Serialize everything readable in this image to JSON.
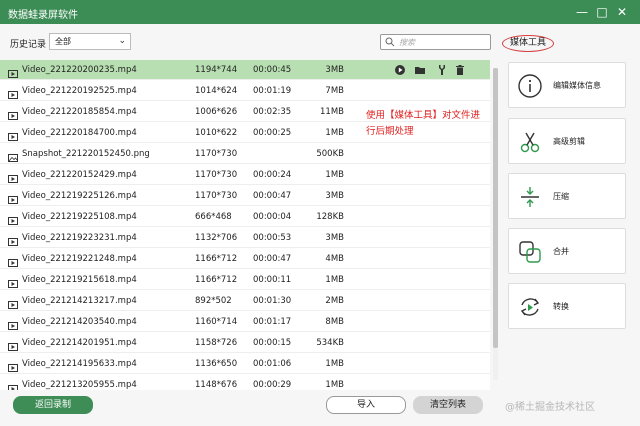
{
  "window": {
    "title": "数据蛙录屏软件",
    "min_icon": "minimize-icon",
    "max_icon": "maximize-icon",
    "close_icon": "close-icon"
  },
  "filter": {
    "label": "历史记录",
    "value": "全部"
  },
  "search": {
    "placeholder": "搜索"
  },
  "media_tab": {
    "label": "媒体工具"
  },
  "annotation": {
    "text": "使用【媒体工具】对文件进行后期处理"
  },
  "files": [
    {
      "name": "Video_221220200235.mp4",
      "resolution": "1194*744",
      "duration": "00:00:45",
      "size": "3MB",
      "type": "video",
      "selected": true
    },
    {
      "name": "Video_221220192525.mp4",
      "resolution": "1014*624",
      "duration": "00:01:19",
      "size": "7MB",
      "type": "video"
    },
    {
      "name": "Video_221220185854.mp4",
      "resolution": "1006*626",
      "duration": "00:02:35",
      "size": "11MB",
      "type": "video"
    },
    {
      "name": "Video_221220184700.mp4",
      "resolution": "1010*622",
      "duration": "00:00:25",
      "size": "1MB",
      "type": "video"
    },
    {
      "name": "Snapshot_221220152450.png",
      "resolution": "1170*730",
      "duration": "",
      "size": "500KB",
      "type": "image"
    },
    {
      "name": "Video_221220152429.mp4",
      "resolution": "1170*730",
      "duration": "00:00:24",
      "size": "1MB",
      "type": "video"
    },
    {
      "name": "Video_221219225126.mp4",
      "resolution": "1170*730",
      "duration": "00:00:47",
      "size": "3MB",
      "type": "video"
    },
    {
      "name": "Video_221219225108.mp4",
      "resolution": "666*468",
      "duration": "00:00:04",
      "size": "128KB",
      "type": "video"
    },
    {
      "name": "Video_221219223231.mp4",
      "resolution": "1132*706",
      "duration": "00:00:53",
      "size": "3MB",
      "type": "video"
    },
    {
      "name": "Video_221219221248.mp4",
      "resolution": "1166*712",
      "duration": "00:00:47",
      "size": "4MB",
      "type": "video"
    },
    {
      "name": "Video_221219215618.mp4",
      "resolution": "1166*712",
      "duration": "00:00:11",
      "size": "1MB",
      "type": "video"
    },
    {
      "name": "Video_221214213217.mp4",
      "resolution": "892*502",
      "duration": "00:01:30",
      "size": "2MB",
      "type": "video"
    },
    {
      "name": "Video_221214203540.mp4",
      "resolution": "1160*714",
      "duration": "00:01:17",
      "size": "8MB",
      "type": "video"
    },
    {
      "name": "Video_221214201951.mp4",
      "resolution": "1158*726",
      "duration": "00:00:15",
      "size": "534KB",
      "type": "video"
    },
    {
      "name": "Video_221214195633.mp4",
      "resolution": "1136*650",
      "duration": "00:01:06",
      "size": "1MB",
      "type": "video"
    },
    {
      "name": "Video_221213205955.mp4",
      "resolution": "1148*676",
      "duration": "00:00:29",
      "size": "1MB",
      "type": "video"
    }
  ],
  "row_actions": [
    "play-icon",
    "folder-icon",
    "trim-icon",
    "delete-icon"
  ],
  "tools": [
    {
      "label": "编辑媒体信息",
      "icon": "info-icon"
    },
    {
      "label": "高级剪辑",
      "icon": "scissors-icon"
    },
    {
      "label": "压缩",
      "icon": "compress-icon"
    },
    {
      "label": "合并",
      "icon": "merge-icon"
    },
    {
      "label": "转换",
      "icon": "convert-icon"
    }
  ],
  "buttons": {
    "back": "返回录制",
    "import": "导入",
    "clear": "清空列表"
  },
  "watermark": "@稀土掘金技术社区",
  "colors": {
    "accent": "#3c8c56",
    "selected_row": "#b8dfb1",
    "annotation": "#e02020"
  }
}
